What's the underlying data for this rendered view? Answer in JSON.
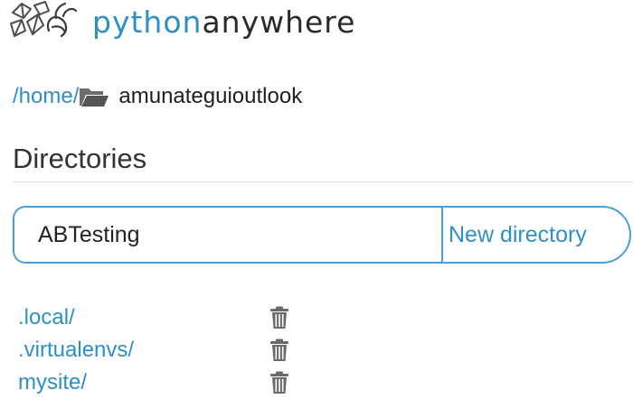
{
  "header": {
    "brand_part1": "python",
    "brand_part2": "anywhere",
    "logo_icon": "pythonanywhere-logo-icon"
  },
  "breadcrumb": {
    "home_label": "/home/",
    "folder_icon": "folder-icon",
    "current": "amunateguioutlook"
  },
  "directories": {
    "title": "Directories",
    "input_value": "ABTesting",
    "new_button_label": "New directory",
    "items": [
      {
        "label": ".local/",
        "delete_icon": "trash-icon"
      },
      {
        "label": ".virtualenvs/",
        "delete_icon": "trash-icon"
      },
      {
        "label": "mysite/",
        "delete_icon": "trash-icon"
      }
    ]
  },
  "colors": {
    "accent": "#2f8fc4",
    "border": "#4a9fd0",
    "text": "#222222"
  }
}
